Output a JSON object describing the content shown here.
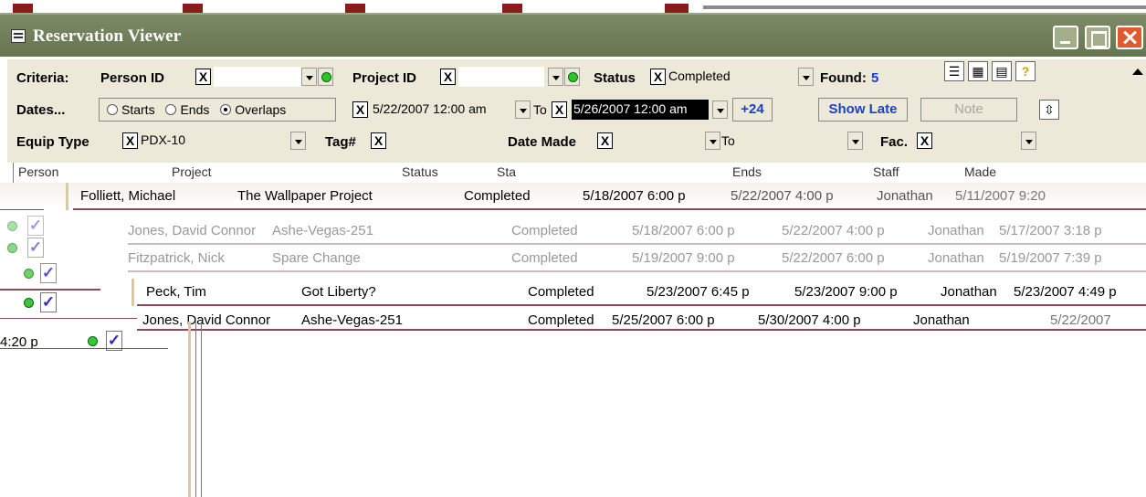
{
  "window": {
    "title": "Reservation Viewer"
  },
  "criteria": {
    "label": "Criteria:",
    "person_id_label": "Person ID",
    "person_id_value": "",
    "project_id_label": "Project ID",
    "project_id_value": "",
    "status_label": "Status",
    "status_value": "Completed",
    "found_label": "Found:",
    "found_value": "5",
    "x_mark": "X"
  },
  "dates": {
    "label": "Dates...",
    "radio_starts": "Starts",
    "radio_ends": "Ends",
    "radio_overlaps": "Overlaps",
    "selected": "Overlaps",
    "from_value": "5/22/2007 12:00 am",
    "to_label": "To",
    "to_value": "5/26/2007 12:00 am",
    "plus_button": "+24",
    "show_late_button": "Show Late",
    "note_button": "Note"
  },
  "equip": {
    "equip_type_label": "Equip Type",
    "equip_type_value": "PDX-10",
    "tag_label": "Tag#",
    "tag_value": "",
    "date_made_label": "Date Made",
    "date_made_value": "",
    "to_label": "To",
    "to_value": "",
    "fac_label": "Fac.",
    "fac_value": ""
  },
  "grid": {
    "headers": [
      "Person",
      "Project",
      "Status",
      "Sta",
      "Ends",
      "Staff",
      "Made"
    ],
    "rows": [
      {
        "person": "Folliett, Michael",
        "project": "The Wallpaper Project",
        "status": "Completed",
        "starts": "5/18/2007 6:00 p",
        "ends": "5/22/2007 4:00 p",
        "staff": "Jonathan",
        "made": "5/11/2007 9:20"
      },
      {
        "person": "Jones, David Connor",
        "project": "Ashe-Vegas-251",
        "status": "Completed",
        "starts": "5/18/2007 6:00 p",
        "ends": "5/22/2007 4:00 p",
        "staff": "Jonathan",
        "made": "5/17/2007 3:18 p"
      },
      {
        "person": "Fitzpatrick, Nick",
        "project": "Spare Change",
        "status": "Completed",
        "starts": "5/19/2007 9:00 p",
        "ends": "5/22/2007 6:00 p",
        "staff": "Jonathan",
        "made": "5/19/2007 7:39 p"
      },
      {
        "person": "Peck, Tim",
        "project": "Got Liberty?",
        "status": "Completed",
        "starts": "5/23/2007 6:45 p",
        "ends": "5/23/2007 9:00 p",
        "staff": "Jonathan",
        "made": "5/23/2007 4:49 p"
      },
      {
        "person": "Jones, David Connor",
        "project": "Ashe-Vegas-251",
        "status": "Completed",
        "starts": "5/25/2007 6:00 p",
        "ends": "5/30/2007 4:00 p",
        "staff": "Jonathan",
        "made": "5/22/2007"
      }
    ],
    "fragment_time": "4:20 p",
    "check_glyph": "✓"
  }
}
